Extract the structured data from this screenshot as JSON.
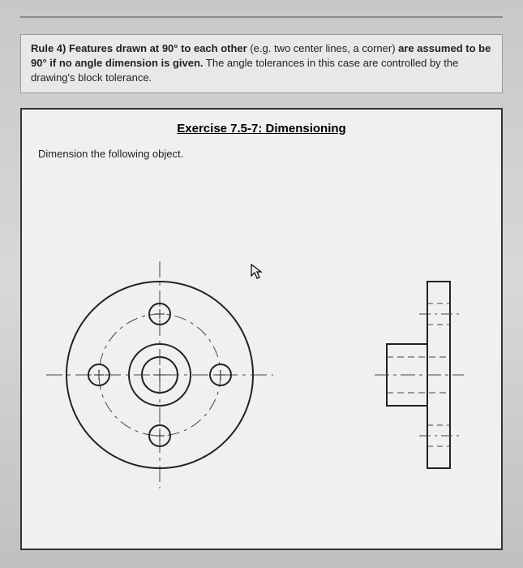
{
  "rule": {
    "bold_part1": "Rule 4) Features drawn at 90° to each other",
    "plain_part1": " (e.g. two center lines, a corner) ",
    "bold_part2": "are assumed to be 90° if no angle dimension is given.",
    "plain_part2": " The angle tolerances in this case are controlled by the drawing's block tolerance."
  },
  "exercise": {
    "title": "Exercise 7.5-7:  Dimensioning",
    "instruction": "Dimension the following object."
  }
}
